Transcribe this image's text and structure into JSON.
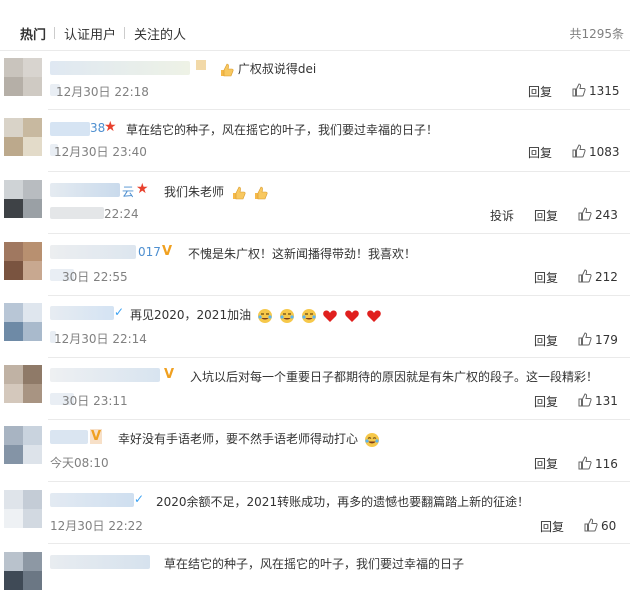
{
  "tabs": {
    "hot": "热门",
    "verified": "认证用户",
    "following": "关注的人",
    "total": "共1295条"
  },
  "comments": [
    {
      "name_tail": "",
      "badge": "",
      "text": "广权叔说得dei",
      "time": "12月30日 22:18",
      "reply": "回复",
      "report": "",
      "likes": "1315"
    },
    {
      "name_tail": "38",
      "badge": "star",
      "text": "草在结它的种子，风在摇它的叶子，我们要过幸福的日子！",
      "time": "12月30日 23:40",
      "reply": "回复",
      "report": "",
      "likes": "1083"
    },
    {
      "name_tail": "云",
      "badge": "star",
      "text": "我们朱老师",
      "time": "22:24",
      "reply": "回复",
      "report": "投诉",
      "likes": "243"
    },
    {
      "name_tail": "017",
      "badge": "vip",
      "text": "不愧是朱广权！这新闻播得带劲！我喜欢！",
      "time": "30日 22:55",
      "reply": "回复",
      "report": "",
      "likes": "212"
    },
    {
      "name_tail": "",
      "badge": "blue",
      "text": "再见2020，2021加油",
      "time": "12月30日 22:14",
      "reply": "回复",
      "report": "",
      "likes": "179"
    },
    {
      "name_tail": "",
      "badge": "vip",
      "text": "入坑以后对每一个重要日子都期待的原因就是有朱广权的段子。这一段精彩！",
      "time": "30日 23:11",
      "reply": "回复",
      "report": "",
      "likes": "131"
    },
    {
      "name_tail": "",
      "badge": "vip",
      "text": "幸好没有手语老师，要不然手语老师得动打心",
      "time": "今天08:10",
      "reply": "回复",
      "report": "",
      "likes": "116"
    },
    {
      "name_tail": "",
      "badge": "blue",
      "text": "2020余额不足，2021转账成功，再多的遗憾也要翻篇踏上新的征途！",
      "time": "12月30日 22:22",
      "reply": "回复",
      "report": "",
      "likes": "60"
    },
    {
      "name_tail": "",
      "badge": "",
      "text": "草在结它的种子，风在摇它的叶子，我们要过幸福的日子",
      "time": "",
      "reply": "",
      "report": "",
      "likes": ""
    }
  ],
  "badge_symbols": {
    "star": "★",
    "vip": "V",
    "blue": "✓"
  },
  "icons": {
    "like": "thumbs-up-icon",
    "emoji_clap": "thumbs-up-emoji",
    "emoji_heart": "heart-emoji",
    "emoji_cry": "crying-laughing-emoji"
  },
  "colors": {
    "link": "#4e8fd0",
    "muted": "#808080",
    "star": "#e8412e",
    "vip": "#f0a020",
    "heart": "#e0201e",
    "divider": "#eaeaea"
  }
}
